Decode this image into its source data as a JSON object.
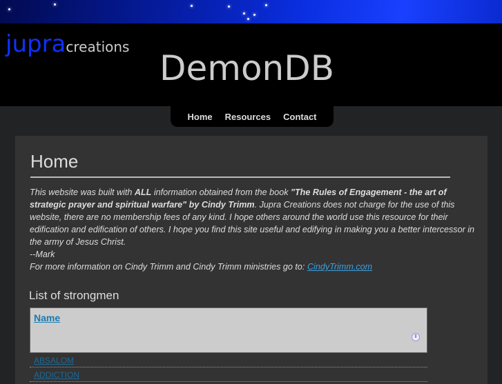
{
  "header": {
    "logo_main": "jupra",
    "logo_sub": "creations",
    "site_title": "DemonDB"
  },
  "nav": [
    "Home",
    "Resources",
    "Contact"
  ],
  "page": {
    "heading": "Home",
    "intro_1": "This website was built with ",
    "intro_bold1": "ALL",
    "intro_2": " information obtained from the book ",
    "intro_bold2": "\"The Rules of Engagement - the art of strategic prayer and spiritual warfare\" by Cindy Trimm",
    "intro_3": ". Jupra Creations does not charge for the use of this website, there are no membership fees of any kind. I hope others around the world use this resource for their edification and edification of others. I hope you find this site useful and edifying in making you a better intercessor in the army of Jesus Christ.",
    "signature": "--Mark",
    "more_info": "For more information on Cindy Trimm and Cindy Trimm ministries go to: ",
    "link": "CindyTrimm.com"
  },
  "list": {
    "heading": "List of strongmen",
    "column": "Name",
    "rows": [
      "ABSALOM",
      "ADDICTION"
    ]
  }
}
